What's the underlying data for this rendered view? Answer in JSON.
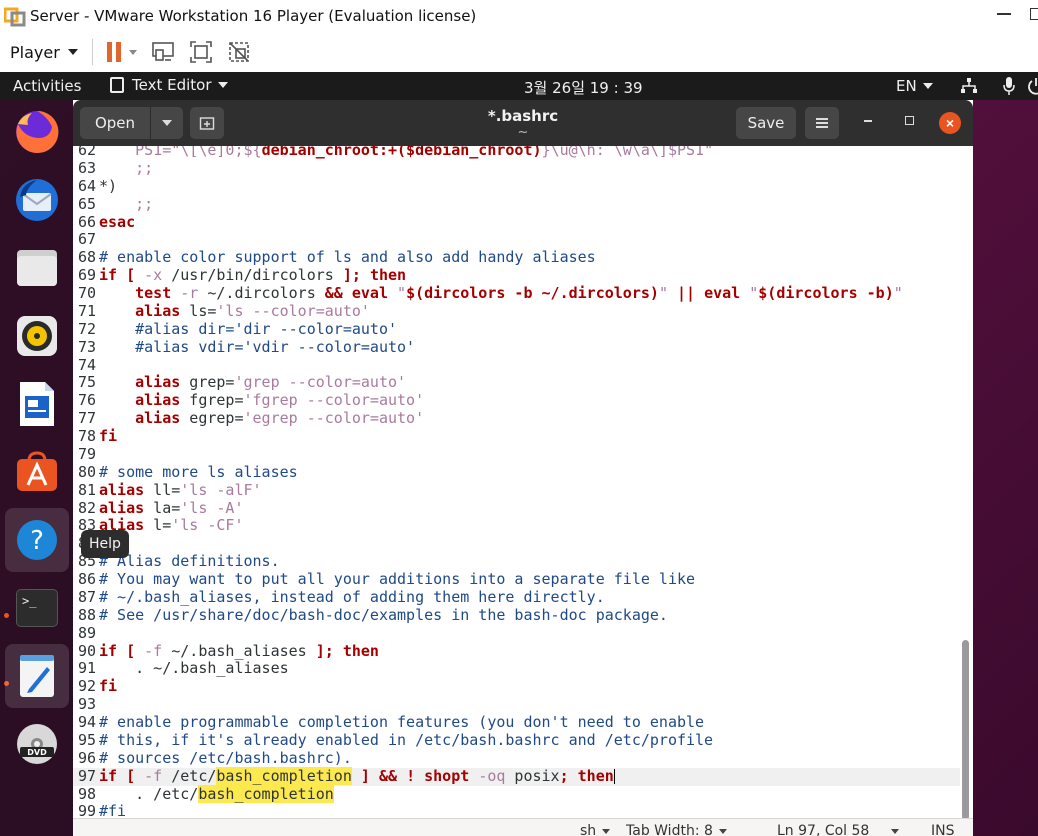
{
  "vmware": {
    "title": "Server - VMware Workstation 16 Player (Evaluation license)",
    "player_label": "Player",
    "colors": {
      "pause": "#e2662c",
      "logo": "#f5a623"
    }
  },
  "topbar": {
    "activities": "Activities",
    "app_menu": "Text Editor",
    "clock": "3월 26일  19 : 39",
    "language": "EN"
  },
  "dock": {
    "items": [
      "firefox-icon",
      "thunderbird-icon",
      "files-icon",
      "rhythmbox-icon",
      "writer-icon",
      "software-icon",
      "help-icon",
      "terminal-icon",
      "text-editor-icon",
      "dvd-icon"
    ],
    "tooltip": "Help",
    "terminal_glyph": ">_"
  },
  "gedit": {
    "open_label": "Open",
    "title": "*.bashrc",
    "subtitle": "~",
    "save_label": "Save",
    "close_glyph": "×",
    "accent": "#e95420"
  },
  "status": {
    "language": "sh",
    "tab_width": "Tab Width: 8",
    "position": "Ln 97, Col 58",
    "mode": "INS"
  },
  "code": {
    "current_line": 97,
    "lines": [
      {
        "n": "62",
        "segs": [
          [
            "n",
            "    "
          ],
          [
            "s",
            "PS1="
          ],
          [
            "s",
            "\"\\[\\e]0;${"
          ],
          [
            "k",
            "debian_chroot"
          ],
          [
            "k",
            ":+($debian_chroot)"
          ],
          [
            "s",
            "}\\u@\\h: \\w\\a\\]$PS1\""
          ]
        ]
      },
      {
        "n": "63",
        "segs": [
          [
            "n",
            "    "
          ],
          [
            "s",
            ";;"
          ]
        ]
      },
      {
        "n": "64",
        "segs": [
          [
            "n",
            "*)"
          ]
        ]
      },
      {
        "n": "65",
        "segs": [
          [
            "n",
            "    "
          ],
          [
            "s",
            ";;"
          ]
        ]
      },
      {
        "n": "66",
        "segs": [
          [
            "k",
            "esac"
          ]
        ]
      },
      {
        "n": "67",
        "segs": []
      },
      {
        "n": "68",
        "segs": [
          [
            "c",
            "# enable color support of ls and also add handy aliases"
          ]
        ]
      },
      {
        "n": "69",
        "segs": [
          [
            "k",
            "if"
          ],
          [
            "n",
            " "
          ],
          [
            "k",
            "["
          ],
          [
            "n",
            " "
          ],
          [
            "s",
            "-x"
          ],
          [
            "n",
            " /usr/bin/dircolors "
          ],
          [
            "k",
            "];"
          ],
          [
            "n",
            " "
          ],
          [
            "k",
            "then"
          ]
        ]
      },
      {
        "n": "70",
        "segs": [
          [
            "n",
            "    "
          ],
          [
            "k",
            "test"
          ],
          [
            "n",
            " "
          ],
          [
            "s",
            "-r"
          ],
          [
            "n",
            " ~/.dircolors "
          ],
          [
            "k",
            "&&"
          ],
          [
            "n",
            " "
          ],
          [
            "k",
            "eval"
          ],
          [
            "n",
            " "
          ],
          [
            "s",
            "\""
          ],
          [
            "k",
            "$(dircolors -b ~/.dircolors)"
          ],
          [
            "s",
            "\""
          ],
          [
            "n",
            " "
          ],
          [
            "k",
            "||"
          ],
          [
            "n",
            " "
          ],
          [
            "k",
            "eval"
          ],
          [
            "n",
            " "
          ],
          [
            "s",
            "\""
          ],
          [
            "k",
            "$(dircolors -b)"
          ],
          [
            "s",
            "\""
          ]
        ]
      },
      {
        "n": "71",
        "segs": [
          [
            "n",
            "    "
          ],
          [
            "k",
            "alias"
          ],
          [
            "n",
            " ls="
          ],
          [
            "s",
            "'ls --color=auto'"
          ]
        ]
      },
      {
        "n": "72",
        "segs": [
          [
            "n",
            "    "
          ],
          [
            "c",
            "#alias dir='dir --color=auto'"
          ]
        ]
      },
      {
        "n": "73",
        "segs": [
          [
            "n",
            "    "
          ],
          [
            "c",
            "#alias vdir='vdir --color=auto'"
          ]
        ]
      },
      {
        "n": "74",
        "segs": []
      },
      {
        "n": "75",
        "segs": [
          [
            "n",
            "    "
          ],
          [
            "k",
            "alias"
          ],
          [
            "n",
            " grep="
          ],
          [
            "s",
            "'grep --color=auto'"
          ]
        ]
      },
      {
        "n": "76",
        "segs": [
          [
            "n",
            "    "
          ],
          [
            "k",
            "alias"
          ],
          [
            "n",
            " fgrep="
          ],
          [
            "s",
            "'fgrep --color=auto'"
          ]
        ]
      },
      {
        "n": "77",
        "segs": [
          [
            "n",
            "    "
          ],
          [
            "k",
            "alias"
          ],
          [
            "n",
            " egrep="
          ],
          [
            "s",
            "'egrep --color=auto'"
          ]
        ]
      },
      {
        "n": "78",
        "segs": [
          [
            "k",
            "fi"
          ]
        ]
      },
      {
        "n": "79",
        "segs": []
      },
      {
        "n": "80",
        "segs": [
          [
            "c",
            "# some more ls aliases"
          ]
        ]
      },
      {
        "n": "81",
        "segs": [
          [
            "k",
            "alias"
          ],
          [
            "n",
            " ll="
          ],
          [
            "s",
            "'ls -alF'"
          ]
        ]
      },
      {
        "n": "82",
        "segs": [
          [
            "k",
            "alias"
          ],
          [
            "n",
            " la="
          ],
          [
            "s",
            "'ls -A'"
          ]
        ]
      },
      {
        "n": "83",
        "segs": [
          [
            "k",
            "alias"
          ],
          [
            "n",
            " l="
          ],
          [
            "s",
            "'ls -CF'"
          ]
        ]
      },
      {
        "n": "84",
        "segs": []
      },
      {
        "n": "85",
        "segs": [
          [
            "c",
            "# Alias definitions."
          ]
        ]
      },
      {
        "n": "86",
        "segs": [
          [
            "c",
            "# You may want to put all your additions into a separate file like"
          ]
        ]
      },
      {
        "n": "87",
        "segs": [
          [
            "c",
            "# ~/.bash_aliases, instead of adding them here directly."
          ]
        ]
      },
      {
        "n": "88",
        "segs": [
          [
            "c",
            "# See /usr/share/doc/bash-doc/examples in the bash-doc package."
          ]
        ]
      },
      {
        "n": "89",
        "segs": []
      },
      {
        "n": "90",
        "segs": [
          [
            "k",
            "if"
          ],
          [
            "n",
            " "
          ],
          [
            "k",
            "["
          ],
          [
            "n",
            " "
          ],
          [
            "s",
            "-f"
          ],
          [
            "n",
            " ~/.bash_aliases "
          ],
          [
            "k",
            "];"
          ],
          [
            "n",
            " "
          ],
          [
            "k",
            "then"
          ]
        ]
      },
      {
        "n": "91",
        "segs": [
          [
            "n",
            "    . ~/.bash_aliases"
          ]
        ]
      },
      {
        "n": "92",
        "segs": [
          [
            "k",
            "fi"
          ]
        ]
      },
      {
        "n": "93",
        "segs": []
      },
      {
        "n": "94",
        "segs": [
          [
            "c",
            "# enable programmable completion features (you don't need to enable"
          ]
        ]
      },
      {
        "n": "95",
        "segs": [
          [
            "c",
            "# this, if it's already enabled in /etc/bash.bashrc and /etc/profile"
          ]
        ]
      },
      {
        "n": "96",
        "segs": [
          [
            "c",
            "# sources /etc/bash.bashrc)."
          ]
        ]
      },
      {
        "n": "97",
        "segs": [
          [
            "k",
            "if"
          ],
          [
            "n",
            " "
          ],
          [
            "k",
            "["
          ],
          [
            "n",
            " "
          ],
          [
            "s",
            "-f"
          ],
          [
            "n",
            " /etc/"
          ],
          [
            "h",
            "bash_completion"
          ],
          [
            "n",
            " "
          ],
          [
            "k",
            "]"
          ],
          [
            "n",
            " "
          ],
          [
            "k",
            "&&"
          ],
          [
            "n",
            " "
          ],
          [
            "k",
            "!"
          ],
          [
            "n",
            " "
          ],
          [
            "k",
            "shopt"
          ],
          [
            "n",
            " "
          ],
          [
            "s",
            "-oq"
          ],
          [
            "n",
            " posix"
          ],
          [
            "k",
            ";"
          ],
          [
            "n",
            " "
          ],
          [
            "k",
            "then"
          ],
          [
            "cur",
            ""
          ]
        ]
      },
      {
        "n": "98",
        "segs": [
          [
            "n",
            "    . /etc/"
          ],
          [
            "h",
            "bash_completion"
          ]
        ]
      },
      {
        "n": "99",
        "segs": [
          [
            "c",
            "#fi"
          ]
        ]
      }
    ]
  }
}
